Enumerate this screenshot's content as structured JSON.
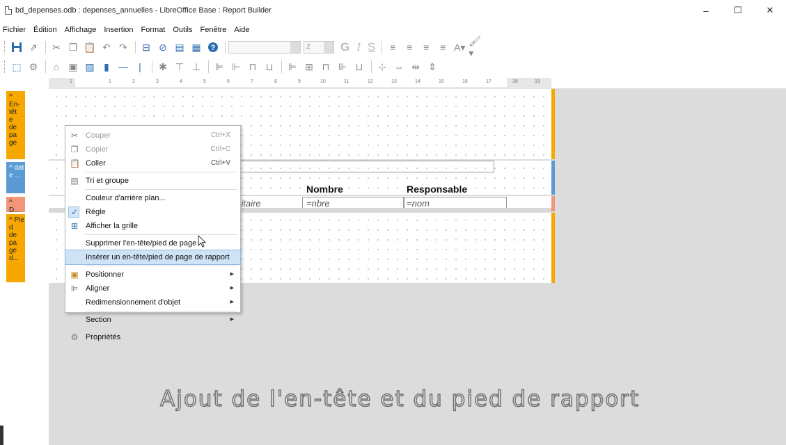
{
  "window": {
    "title": "bd_depenses.odb : depenses_annuelles - LibreOffice Base : Report Builder",
    "minimize": "–",
    "maximize": "☐",
    "close": "✕"
  },
  "menubar": [
    "Fichier",
    "Édition",
    "Affichage",
    "Insertion",
    "Format",
    "Outils",
    "Fenêtre",
    "Aide"
  ],
  "toolbar": {
    "font_size_value": "2",
    "bold_glyph": "G",
    "italic_glyph": "I",
    "underline_glyph": "S"
  },
  "ruler": {
    "ticks": [
      "1",
      "1",
      "2",
      "3",
      "4",
      "5",
      "6",
      "7",
      "8",
      "9",
      "10",
      "11",
      "12",
      "13",
      "14",
      "15",
      "16",
      "17",
      "18",
      "19"
    ]
  },
  "sections": {
    "page_header": "En-tête de page",
    "page_header_lines": [
      "En-",
      "têt",
      "e",
      "de",
      "pa",
      "ge"
    ],
    "data_label_lines": [
      "dat",
      "e ..."
    ],
    "detail_label": "D...",
    "page_footer_lines": [
      "Pie",
      "d",
      "de",
      "pa",
      "ge",
      "d..."
    ]
  },
  "report": {
    "headers": {
      "nombre": "Nombre",
      "responsable": "Responsable"
    },
    "fields": {
      "unitaire": "unitaire",
      "nbre": "=nbre",
      "nom": "=nom"
    }
  },
  "context_menu": {
    "items": [
      {
        "label": "Couper",
        "shortcut": "Ctrl+X"
      },
      {
        "label": "Copier",
        "shortcut": "Ctrl+C"
      },
      {
        "label": "Coller",
        "shortcut": "Ctrl+V"
      },
      {
        "label": "Tri et groupe"
      },
      {
        "label": "Couleur d'arrière plan..."
      },
      {
        "label": "Règle"
      },
      {
        "label": "Afficher la grille"
      },
      {
        "label": "Supprimer l'en-tête/pied de page"
      },
      {
        "label": "Insérer un en-tête/pied de page de rapport"
      },
      {
        "label": "Positionner"
      },
      {
        "label": "Aligner"
      },
      {
        "label": "Redimensionnement d'objet"
      },
      {
        "label": "Section"
      },
      {
        "label": "Propriétés"
      }
    ]
  },
  "watermark": "Ajout de l'en-tête et du pied de rapport",
  "colors": {
    "section_orange": "#f7a800",
    "section_blue": "#5b9bd5",
    "section_salmon": "#f2967a",
    "highlight": "#cfe3f7"
  }
}
